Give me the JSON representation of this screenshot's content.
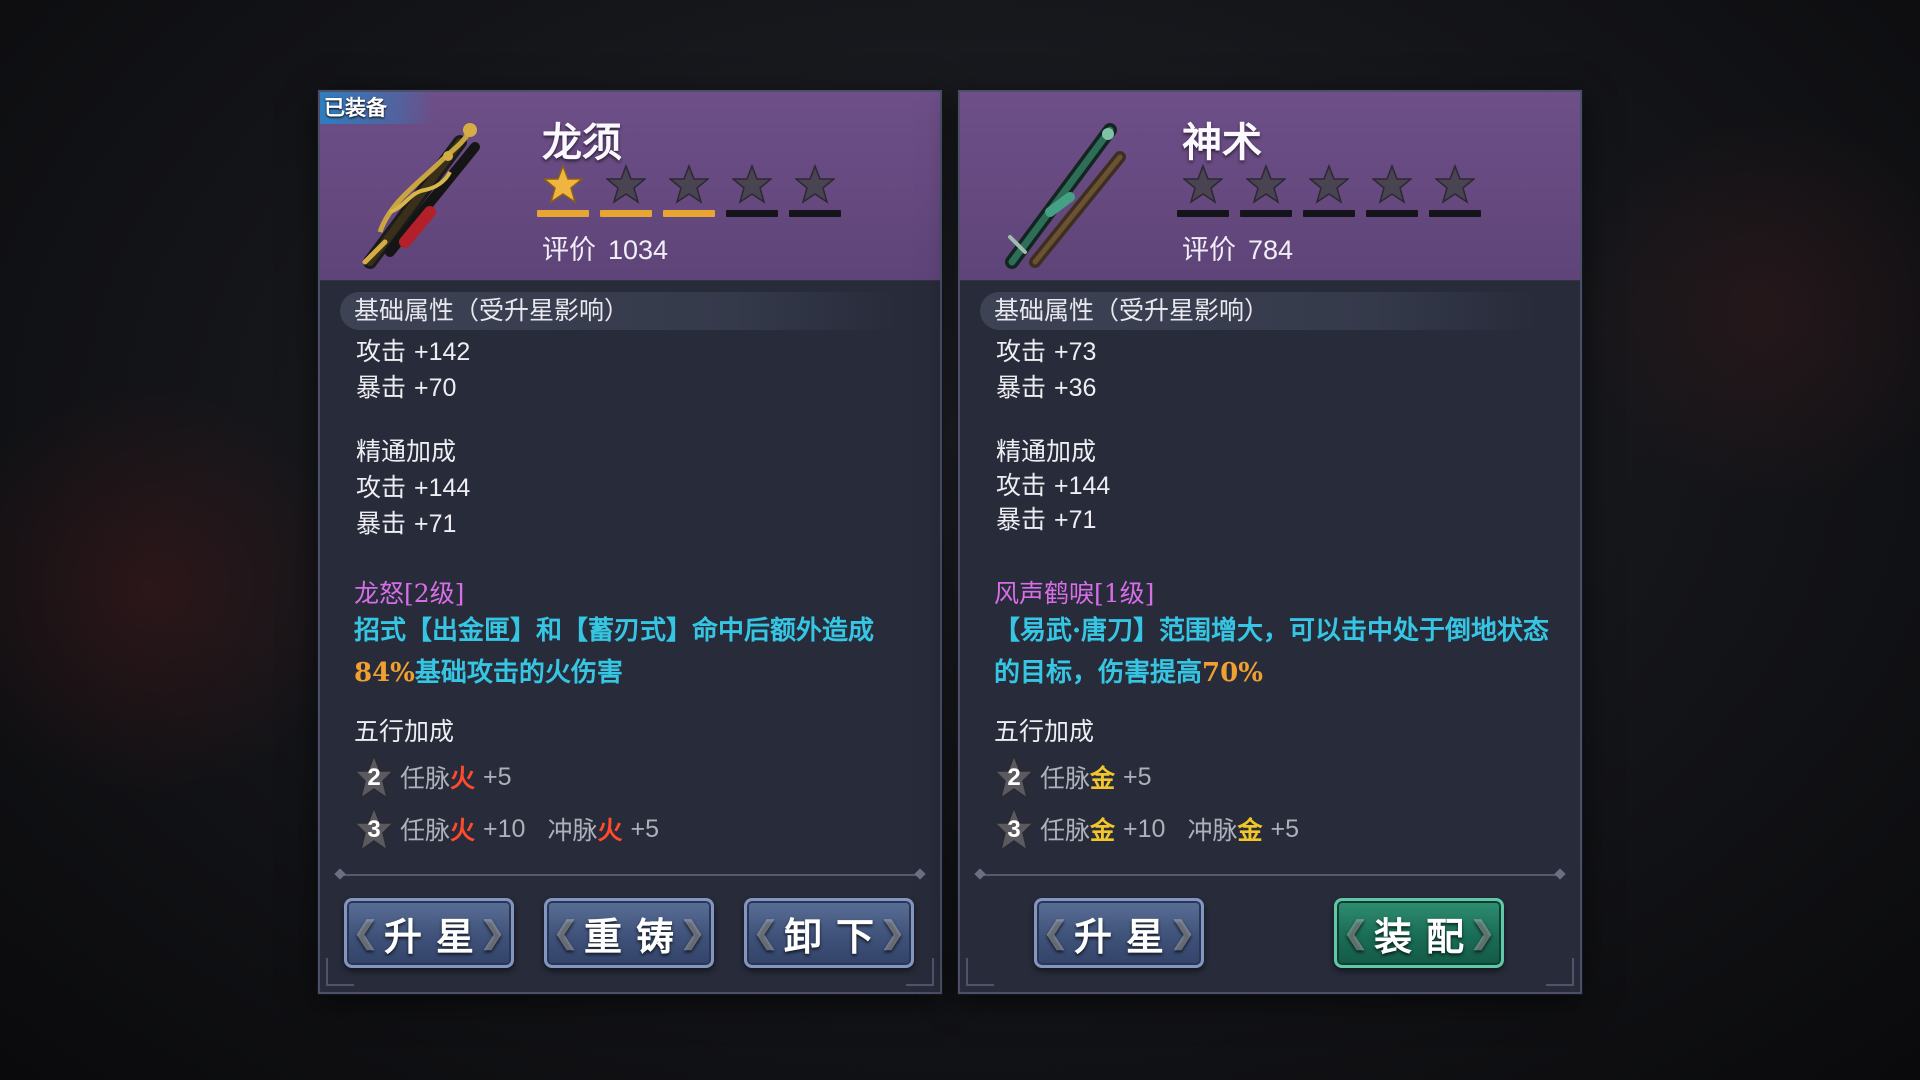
{
  "colors": {
    "accent_star": "#e9a532",
    "skill_title": "#d76ee8",
    "skill_desc": "#36c6e3",
    "highlight": "#f0a030",
    "fire": "#ff4a2c",
    "gold": "#f2c62a"
  },
  "left": {
    "equipped_label": "已装备",
    "name": "龙须",
    "stars_filled": 1,
    "stars_total": 5,
    "rating_label": "评价",
    "rating_value": "1034",
    "base_title": "基础属性（受升星影响）",
    "base_stats": [
      {
        "label": "攻击",
        "value": "+142"
      },
      {
        "label": "暴击",
        "value": "+70"
      }
    ],
    "mastery_title": "精通加成",
    "mastery_stats": [
      {
        "label": "攻击",
        "value": "+144"
      },
      {
        "label": "暴击",
        "value": "+71"
      }
    ],
    "skill_title": "龙怒[2级]",
    "skill_desc_before": "招式【出金匣】和【蓄刃式】命中后额外造成",
    "skill_desc_highlight": "84%",
    "skill_desc_after": "基础攻击的火伤害",
    "five_title": "五行加成",
    "five_rows": [
      {
        "level": "2",
        "entries": [
          {
            "meridian": "任脉",
            "element": "火",
            "value": "+5"
          }
        ]
      },
      {
        "level": "3",
        "entries": [
          {
            "meridian": "任脉",
            "element": "火",
            "value": "+10"
          },
          {
            "meridian": "冲脉",
            "element": "火",
            "value": "+5"
          }
        ]
      }
    ],
    "buttons": {
      "upgrade": "升星",
      "reforge": "重铸",
      "unequip": "卸下"
    }
  },
  "right": {
    "name": "神术",
    "stars_filled": 0,
    "stars_total": 5,
    "rating_label": "评价",
    "rating_value": "784",
    "base_title": "基础属性（受升星影响）",
    "base_stats": [
      {
        "label": "攻击",
        "value": "+73"
      },
      {
        "label": "暴击",
        "value": "+36"
      }
    ],
    "mastery_title": "精通加成",
    "mastery_stats": [
      {
        "label": "攻击",
        "value": "+144"
      },
      {
        "label": "暴击",
        "value": "+71"
      }
    ],
    "skill_title": "风声鹤唳[1级]",
    "skill_desc_before": "【易武·唐刀】范围增大，可以击中处于倒地状态的目标，伤害提高",
    "skill_desc_highlight": "70%",
    "skill_desc_after": "",
    "five_title": "五行加成",
    "five_rows": [
      {
        "level": "2",
        "entries": [
          {
            "meridian": "任脉",
            "element": "金",
            "value": "+5"
          }
        ]
      },
      {
        "level": "3",
        "entries": [
          {
            "meridian": "任脉",
            "element": "金",
            "value": "+10"
          },
          {
            "meridian": "冲脉",
            "element": "金",
            "value": "+5"
          }
        ]
      }
    ],
    "buttons": {
      "upgrade": "升星",
      "equip": "装配"
    }
  }
}
